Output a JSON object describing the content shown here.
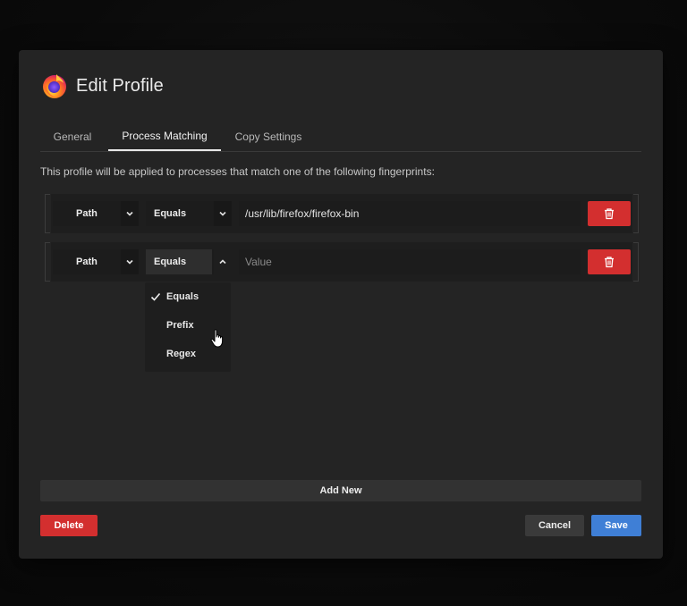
{
  "dialog": {
    "title": "Edit Profile",
    "logo_icon": "firefox-logo-icon"
  },
  "tabs": [
    {
      "label": "General",
      "active": false
    },
    {
      "label": "Process Matching",
      "active": true
    },
    {
      "label": "Copy Settings",
      "active": false
    }
  ],
  "description": "This profile will be applied to processes that match one of the following fingerprints:",
  "fingerprints": [
    {
      "field": "Path",
      "operator": "Equals",
      "value": "/usr/lib/firefox/firefox-bin",
      "placeholder": "Value"
    },
    {
      "field": "Path",
      "operator": "Equals",
      "value": "",
      "placeholder": "Value"
    }
  ],
  "operator_dropdown": {
    "options": [
      {
        "label": "Equals",
        "selected": true
      },
      {
        "label": "Prefix",
        "selected": false
      },
      {
        "label": "Regex",
        "selected": false
      }
    ]
  },
  "buttons": {
    "add_new": "Add New",
    "delete": "Delete",
    "cancel": "Cancel",
    "save": "Save"
  },
  "colors": {
    "danger": "#d32f2f",
    "primary": "#3f7fd6",
    "background": "#242424"
  }
}
